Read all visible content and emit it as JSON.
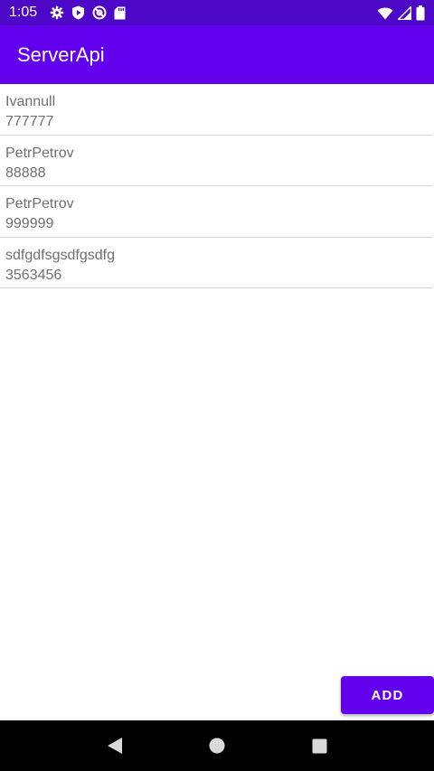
{
  "status_bar": {
    "time": "1:05",
    "icons_left": [
      "gear-icon",
      "shield-play-icon",
      "at-sign-icon",
      "sd-card-icon"
    ],
    "icons_right": [
      "wifi-icon",
      "signal-icon",
      "battery-icon"
    ]
  },
  "app_bar": {
    "title": "ServerApi",
    "color": "#6200ee"
  },
  "contacts": [
    {
      "name": "Ivannull",
      "phone": "777777"
    },
    {
      "name": "PetrPetrov",
      "phone": "88888"
    },
    {
      "name": "PetrPetrov",
      "phone": "999999"
    },
    {
      "name": "sdfgdfsgsdfgsdfg",
      "phone": "3563456"
    }
  ],
  "add_button": {
    "label": "ADD",
    "color": "#6200ee"
  },
  "nav_bar": {
    "icons": [
      "back-icon",
      "home-icon",
      "recents-icon"
    ]
  }
}
